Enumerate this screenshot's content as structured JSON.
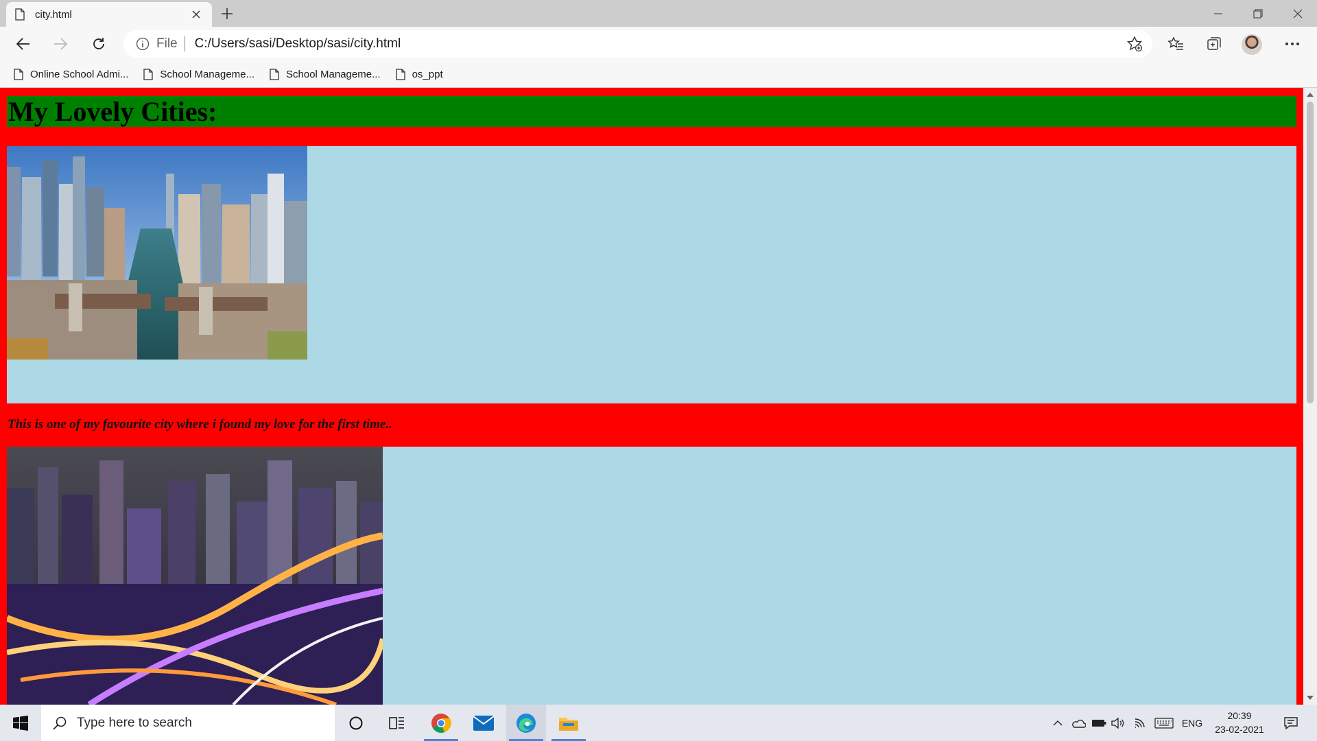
{
  "browser": {
    "tab_title": "city.html",
    "omnibox_scheme": "File",
    "omnibox_url": "C:/Users/sasi/Desktop/sasi/city.html",
    "bookmarks": [
      {
        "label": "Online School Admi..."
      },
      {
        "label": "School Manageme..."
      },
      {
        "label": "School Manageme..."
      },
      {
        "label": "os_ppt"
      }
    ]
  },
  "page": {
    "heading": "My Lovely Cities:",
    "caption": "This is one of my favourite city where i found my love for the first time..",
    "colors": {
      "body": "#ff0000",
      "heading_bg": "#008000",
      "section_bg": "#add8e6"
    }
  },
  "taskbar": {
    "search_placeholder": "Type here to search",
    "tray_language": "ENG",
    "clock_time": "20:39",
    "clock_date": "23-02-2021"
  }
}
